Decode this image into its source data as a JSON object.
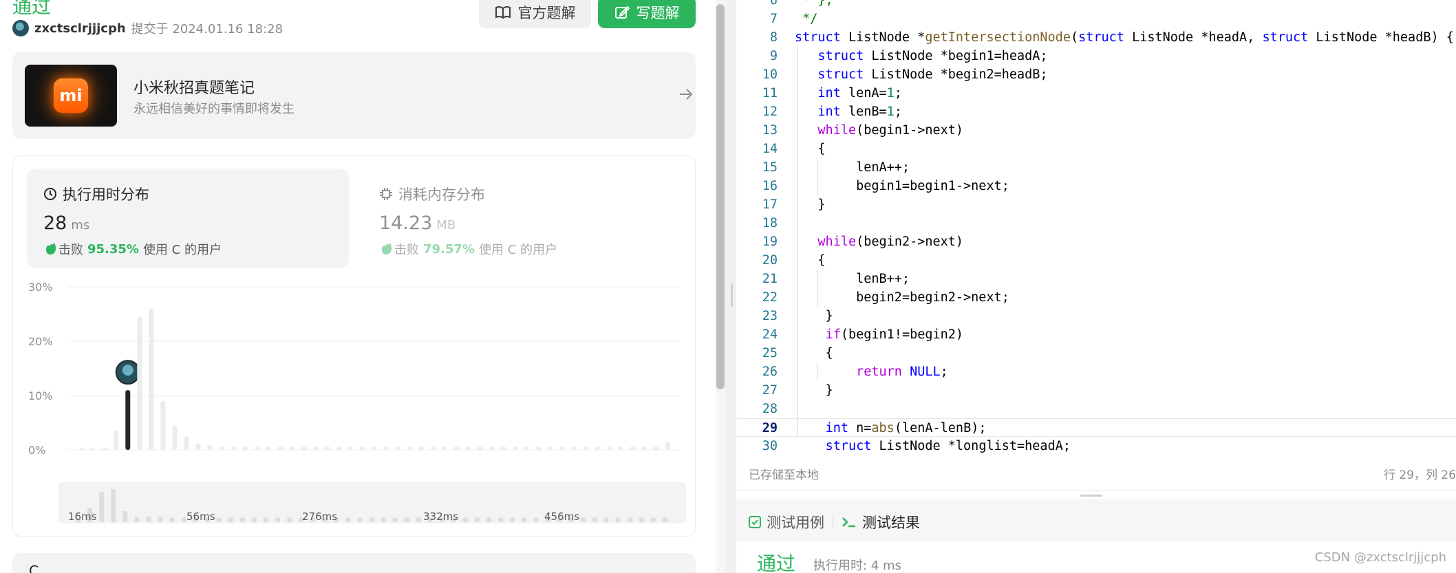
{
  "submission": {
    "status": "通过",
    "username": "zxctsclrjjjcph",
    "submitted": "提交于 2024.01.16 18:28",
    "official_solution_label": "官方题解",
    "write_solution_label": "写题解"
  },
  "note_card": {
    "title": "小米秋招真题笔记",
    "subtitle": "永远相信美好的事情即将发生"
  },
  "stats": {
    "runtime": {
      "title": "执行用时分布",
      "value": "28",
      "unit": "ms",
      "beat_prefix": "击败",
      "beat_pct": "95.35%",
      "beat_suffix": "使用 C 的用户"
    },
    "memory": {
      "title": "消耗内存分布",
      "value": "14.23",
      "unit": "MB",
      "beat_prefix": "击败",
      "beat_pct": "79.57%",
      "beat_suffix": "使用 C 的用户"
    }
  },
  "chart_data": {
    "type": "bar",
    "y_ticks": [
      "30%",
      "20%",
      "10%",
      "0%"
    ],
    "ylim": [
      0,
      30
    ],
    "x_ticks": [
      "16ms",
      "56ms",
      "276ms",
      "332ms",
      "456ms"
    ],
    "values": [
      0.3,
      0.3,
      0.3,
      3.5,
      11,
      24.5,
      26,
      9,
      4.5,
      2.5,
      1.2,
      0.9,
      0.6,
      0.6,
      0.6,
      0.6,
      0.6,
      0.6,
      0.6,
      0.6,
      0.6,
      0.6,
      0.6,
      0.6,
      0.6,
      0.6,
      0.6,
      0.6,
      0.6,
      0.6,
      0.6,
      0.6,
      0.6,
      0.6,
      0.6,
      0.6,
      0.6,
      0.6,
      0.6,
      0.6,
      0.6,
      0.6,
      0.6,
      0.6,
      0.6,
      0.6,
      0.6,
      0.6,
      0.6,
      0.6,
      1.4
    ],
    "highlight_index": 4,
    "mini_values": [
      0.8,
      2.5,
      5.5,
      6,
      2,
      1,
      1,
      1,
      0.8,
      0.8,
      0.8,
      0.8,
      0.8,
      0.8,
      0.8,
      0.8,
      0.8,
      0.8,
      0.8,
      0.8,
      0.8,
      0.8,
      0.8,
      0.8,
      0.8,
      0.8,
      0.8,
      0.8,
      0.8,
      0.8,
      0.8,
      0.8,
      0.8,
      0.8,
      0.8,
      0.8,
      0.8,
      0.8,
      0.8,
      0.8,
      0.8,
      0.8,
      0.8,
      0.8,
      0.8,
      0.8,
      0.8,
      0.8,
      0.8,
      0.8,
      0.8
    ],
    "mini_x_ticks": [
      "16ms",
      "56ms",
      "276ms",
      "332ms",
      "456ms"
    ]
  },
  "lang": "C",
  "editor": {
    "lines": [
      {
        "n": "6",
        "text": " * };"
      },
      {
        "n": "7",
        "text": " */"
      },
      {
        "n": "8",
        "text": "struct ListNode *getIntersectionNode(struct ListNode *headA, struct ListNode *headB) {"
      },
      {
        "n": "9",
        "text": "   struct ListNode *begin1=headA;"
      },
      {
        "n": "10",
        "text": "   struct ListNode *begin2=headB;"
      },
      {
        "n": "11",
        "text": "   int lenA=1;"
      },
      {
        "n": "12",
        "text": "   int lenB=1;"
      },
      {
        "n": "13",
        "text": "   while(begin1->next)"
      },
      {
        "n": "14",
        "text": "   {"
      },
      {
        "n": "15",
        "text": "        lenA++;"
      },
      {
        "n": "16",
        "text": "        begin1=begin1->next;"
      },
      {
        "n": "17",
        "text": "   }"
      },
      {
        "n": "18",
        "text": ""
      },
      {
        "n": "19",
        "text": "   while(begin2->next)"
      },
      {
        "n": "20",
        "text": "   {"
      },
      {
        "n": "21",
        "text": "        lenB++;"
      },
      {
        "n": "22",
        "text": "        begin2=begin2->next;"
      },
      {
        "n": "23",
        "text": "    }"
      },
      {
        "n": "24",
        "text": "    if(begin1!=begin2)"
      },
      {
        "n": "25",
        "text": "    {"
      },
      {
        "n": "26",
        "text": "        return NULL;"
      },
      {
        "n": "27",
        "text": "    }"
      },
      {
        "n": "28",
        "text": ""
      },
      {
        "n": "29",
        "text": "    int n=abs(lenA-lenB);"
      },
      {
        "n": "30",
        "text": "    struct ListNode *longlist=headA;"
      }
    ],
    "current_line": "29",
    "saved_status": "已存储至本地",
    "cursor_pos": "行 29，列 26"
  },
  "test_panel": {
    "tab_cases": "测试用例",
    "tab_results": "测试结果",
    "result": "通过",
    "runtime": "执行用时: 4 ms"
  },
  "watermark": "CSDN @zxctsclrjjjcph",
  "colors": {
    "accent_green": "#2db55d",
    "bar_light": "#ececec",
    "bar_highlight": "#262626"
  }
}
